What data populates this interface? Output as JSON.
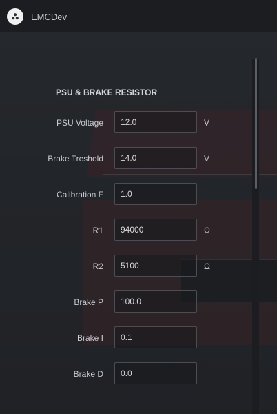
{
  "window": {
    "title": "EMCDev",
    "app_icon": "app-logo-icon"
  },
  "section": {
    "title": "PSU & BRAKE RESISTOR"
  },
  "fields": [
    {
      "label": "PSU Voltage",
      "value": "12.0",
      "unit": "V"
    },
    {
      "label": "Brake Treshold",
      "value": "14.0",
      "unit": "V"
    },
    {
      "label": "Calibration F",
      "value": "1.0",
      "unit": ""
    },
    {
      "label": "R1",
      "value": "94000",
      "unit": "Ω"
    },
    {
      "label": "R2",
      "value": "5100",
      "unit": "Ω"
    },
    {
      "label": "Brake P",
      "value": "100.0",
      "unit": ""
    },
    {
      "label": "Brake I",
      "value": "0.1",
      "unit": ""
    },
    {
      "label": "Brake D",
      "value": "0.0",
      "unit": ""
    }
  ]
}
